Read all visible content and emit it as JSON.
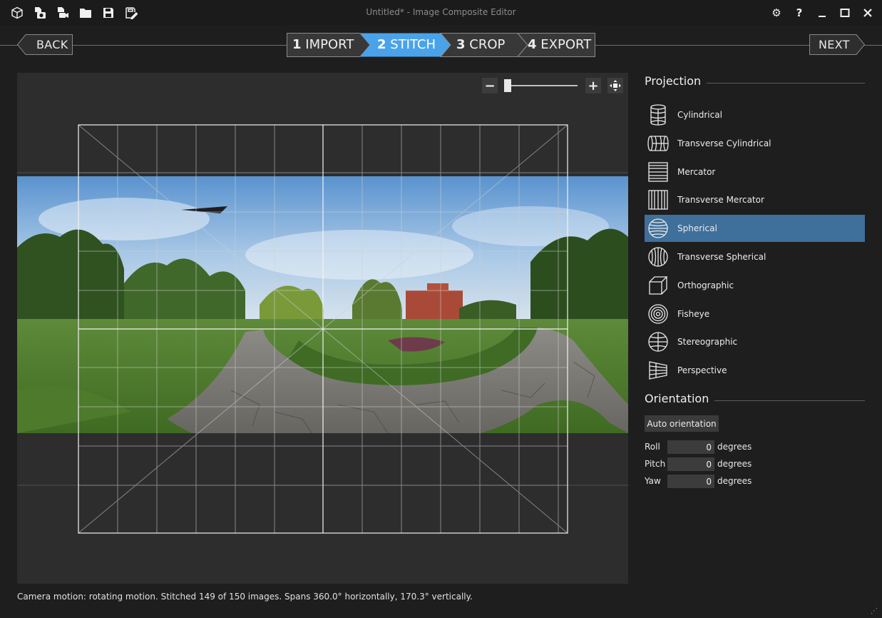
{
  "app": {
    "title": "Untitled* - Image Composite Editor"
  },
  "toolbar": {
    "icons": [
      "new-panorama-icon",
      "new-from-images-icon",
      "new-from-video-icon",
      "open-project-icon",
      "save-project-icon",
      "save-as-icon"
    ]
  },
  "window_controls": {
    "settings": "⚙",
    "help": "?"
  },
  "nav": {
    "back_label": "BACK",
    "next_label": "NEXT",
    "steps": [
      {
        "num": "1",
        "label": "IMPORT"
      },
      {
        "num": "2",
        "label": "STITCH"
      },
      {
        "num": "3",
        "label": "CROP"
      },
      {
        "num": "4",
        "label": "EXPORT"
      }
    ],
    "active_step": 2
  },
  "zoom": {
    "minus": "−",
    "plus": "+",
    "level": 0.0
  },
  "projection": {
    "heading": "Projection",
    "items": [
      {
        "label": "Cylindrical",
        "icon": "cylindrical-icon"
      },
      {
        "label": "Transverse Cylindrical",
        "icon": "transverse-cylindrical-icon"
      },
      {
        "label": "Mercator",
        "icon": "mercator-icon"
      },
      {
        "label": "Transverse Mercator",
        "icon": "transverse-mercator-icon"
      },
      {
        "label": "Spherical",
        "icon": "spherical-icon"
      },
      {
        "label": "Transverse Spherical",
        "icon": "transverse-spherical-icon"
      },
      {
        "label": "Orthographic",
        "icon": "orthographic-icon"
      },
      {
        "label": "Fisheye",
        "icon": "fisheye-icon"
      },
      {
        "label": "Stereographic",
        "icon": "stereographic-icon"
      },
      {
        "label": "Perspective",
        "icon": "perspective-icon"
      }
    ],
    "selected": "Spherical"
  },
  "orientation": {
    "heading": "Orientation",
    "auto_label": "Auto orientation",
    "roll": {
      "label": "Roll",
      "value": "0",
      "unit": "degrees"
    },
    "pitch": {
      "label": "Pitch",
      "value": "0",
      "unit": "degrees"
    },
    "yaw": {
      "label": "Yaw",
      "value": "0",
      "unit": "degrees"
    }
  },
  "status": {
    "text": "Camera motion: rotating motion. Stitched 149 of 150 images. Spans 360.0° horizontally, 170.3° vertically."
  },
  "colors": {
    "accent": "#3f6f9b",
    "active_step": "#4aa3ea",
    "background": "#1e1e1e",
    "canvas": "#2d2d2d"
  }
}
